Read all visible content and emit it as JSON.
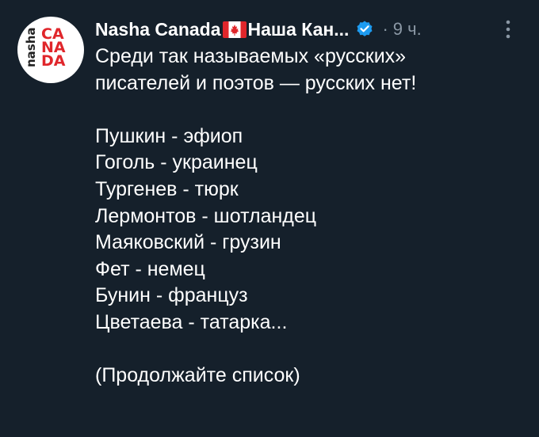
{
  "author": {
    "name_part1": "Nasha Canada",
    "name_part2": "Наша Кан...",
    "time": "9 ч.",
    "separator": "·",
    "avatar_nasha": "nasha",
    "avatar_canada_lines": [
      "CA",
      "NA",
      "DA"
    ]
  },
  "icons": {
    "flag": "canada-flag-icon",
    "verified": "verified-badge-icon",
    "more": "more-options-icon"
  },
  "colors": {
    "background": "#15202b",
    "verified": "#1d9bf0",
    "muted": "#8b98a5",
    "flag_red": "#e0262b"
  },
  "tweet": {
    "intro_line1": "Среди так называемых «русских»",
    "intro_line2": "писателей и поэтов — русских нет!",
    "list": [
      "Пушкин - эфиоп",
      "Гоголь - украинец",
      "Тургенев - тюрк",
      "Лермонтов - шотландец",
      "Маяковский - грузин",
      "Фет - немец",
      "Бунин - француз",
      "Цветаева - татарка..."
    ],
    "closing": "(Продолжайте список)"
  }
}
